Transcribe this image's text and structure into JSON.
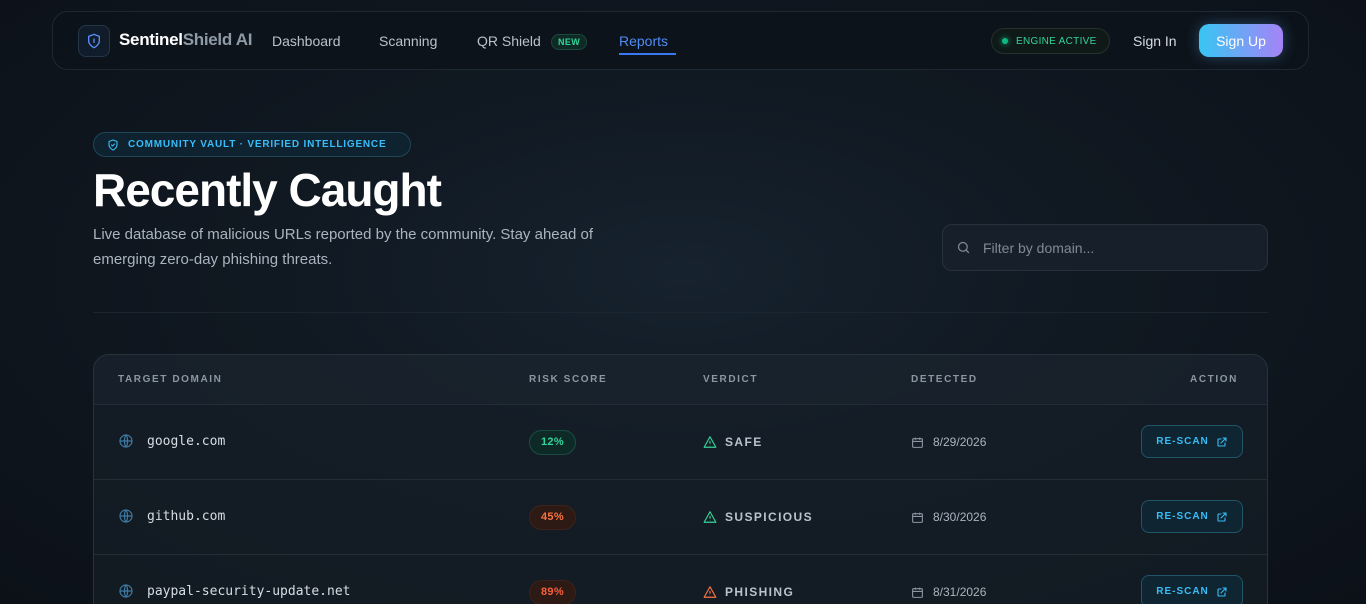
{
  "nav": {
    "brand_part1": "Sentinel",
    "brand_part2": "Shield AI",
    "links": [
      "Dashboard",
      "Scanning",
      "QR Shield",
      "Reports"
    ],
    "new_badge": "NEW",
    "active_link": "Reports",
    "engine_status": "ENGINE ACTIVE",
    "sign_in": "Sign In",
    "sign_up": "Sign Up"
  },
  "hero": {
    "pill": "COMMUNITY VAULT · VERIFIED INTELLIGENCE",
    "title": "Recently Caught",
    "subtitle": "Live database of malicious URLs reported by the community. Stay ahead of emerging zero-day phishing threats."
  },
  "filter": {
    "placeholder": "Filter by domain..."
  },
  "table": {
    "headers": {
      "domain": "TARGET DOMAIN",
      "risk": "RISK SCORE",
      "verdict": "VERDICT",
      "detected": "DETECTED",
      "action": "ACTION"
    },
    "rows": [
      {
        "domain": "google.com",
        "risk": "12%",
        "verdict": "SAFE",
        "detected": "8/29/2026",
        "action": "RE-SCAN"
      },
      {
        "domain": "github.com",
        "risk": "45%",
        "verdict": "SUSPICIOUS",
        "detected": "8/30/2026",
        "action": "RE-SCAN"
      },
      {
        "domain": "paypal-security-update.net",
        "risk": "89%",
        "verdict": "PHISHING",
        "detected": "8/31/2026",
        "action": "RE-SCAN"
      }
    ]
  },
  "colors": {
    "accent_blue": "#3a78f2",
    "safe_green": "#34d399",
    "danger_orange": "#f97341",
    "cyan": "#38bdf8"
  }
}
